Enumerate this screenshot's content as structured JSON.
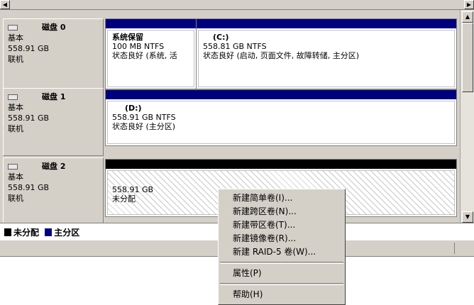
{
  "colors": {
    "primary_partition": "#00007f",
    "unallocated": "#000000",
    "panel_bg": "#d4d0c8"
  },
  "disks": [
    {
      "name": "磁盘 0",
      "type": "基本",
      "size": "558.91 GB",
      "status": "联机",
      "partitions": [
        {
          "name": "系统保留",
          "size_fs": "100 MB NTFS",
          "state": "状态良好 (系统, 活"
        },
        {
          "name": "(C:)",
          "size_fs": "558.81 GB NTFS",
          "state": "状态良好 (启动, 页面文件, 故障转储, 主分区)"
        }
      ]
    },
    {
      "name": "磁盘 1",
      "type": "基本",
      "size": "558.91 GB",
      "status": "联机",
      "partitions": [
        {
          "name": "(D:)",
          "size_fs": "558.91 GB NTFS",
          "state": "状态良好 (主分区)"
        }
      ]
    },
    {
      "name": "磁盘 2",
      "type": "基本",
      "size": "558.91 GB",
      "status": "联机",
      "partitions": [
        {
          "size_fs": "558.91 GB",
          "state": "未分配"
        }
      ]
    }
  ],
  "legend": {
    "unallocated": "未分配",
    "primary": "主分区"
  },
  "context_menu": {
    "items": [
      "新建简单卷(I)...",
      "新建跨区卷(N)...",
      "新建带区卷(T)...",
      "新建镜像卷(R)...",
      "新建 RAID-5 卷(W)..."
    ],
    "properties": "属性(P)",
    "help": "帮助(H)"
  },
  "icons": [
    "scroll-left-icon",
    "scroll-right-icon",
    "scroll-up-icon",
    "scroll-down-icon",
    "disk-icon"
  ]
}
